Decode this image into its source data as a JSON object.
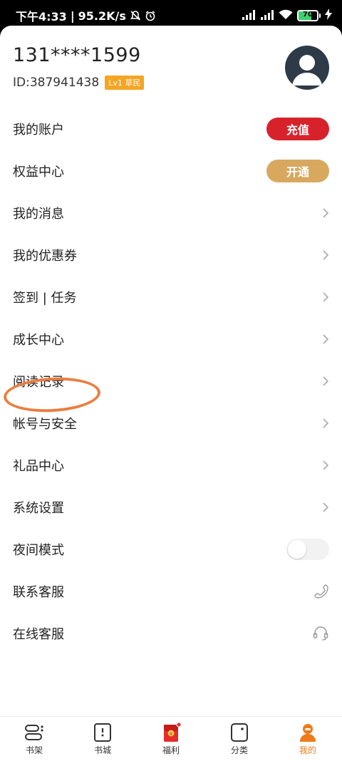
{
  "status_bar": {
    "time": "下午4:33",
    "net_speed": "95.2K/s",
    "separator": "|",
    "battery": "70"
  },
  "profile": {
    "phone": "131****1599",
    "user_id": "ID:387941438",
    "level": "Lv1 草民"
  },
  "menu": {
    "account": {
      "label": "我的账户",
      "button": "充值"
    },
    "benefits": {
      "label": "权益中心",
      "button": "开通"
    },
    "messages": {
      "label": "我的消息"
    },
    "coupons": {
      "label": "我的优惠券"
    },
    "checkin": {
      "label": "签到 | 任务"
    },
    "growth": {
      "label": "成长中心"
    },
    "history": {
      "label": "阅读记录"
    },
    "security": {
      "label": "帐号与安全"
    },
    "gifts": {
      "label": "礼品中心"
    },
    "settings": {
      "label": "系统设置"
    },
    "night": {
      "label": "夜间模式",
      "enabled": false
    },
    "contact": {
      "label": "联系客服"
    },
    "online": {
      "label": "在线客服"
    }
  },
  "tabbar": {
    "tabs": [
      {
        "label": "书架"
      },
      {
        "label": "书城"
      },
      {
        "label": "福利"
      },
      {
        "label": "分类"
      },
      {
        "label": "我的"
      }
    ],
    "active_index": 4
  },
  "colors": {
    "recharge": "#d7222c",
    "activate": "#d7a85e",
    "active_tab": "#f07a18",
    "highlight": "#e97e3f",
    "level_badge": "#f5a524"
  },
  "battery_level": 0.7
}
